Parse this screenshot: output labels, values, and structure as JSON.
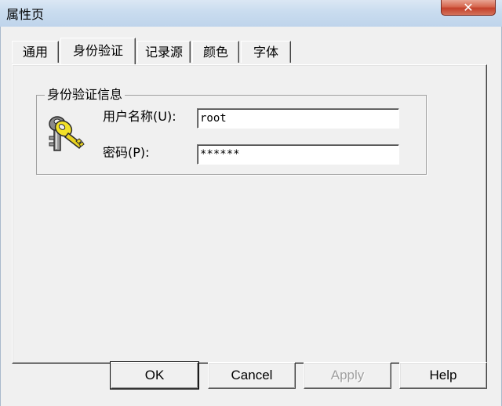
{
  "window": {
    "title": "属性页",
    "close_glyph": "✕"
  },
  "tabs": [
    {
      "label": "通用"
    },
    {
      "label": "身份验证",
      "active": true
    },
    {
      "label": "记录源"
    },
    {
      "label": "颜色"
    },
    {
      "label": "字体"
    }
  ],
  "auth_group": {
    "title": "身份验证信息",
    "icon": "keys-icon",
    "username": {
      "label": "用户名称(U):",
      "value": "root"
    },
    "password": {
      "label": "密码(P):",
      "value": "******"
    }
  },
  "buttons": {
    "ok": "OK",
    "cancel": "Cancel",
    "apply": "Apply",
    "help": "Help"
  }
}
